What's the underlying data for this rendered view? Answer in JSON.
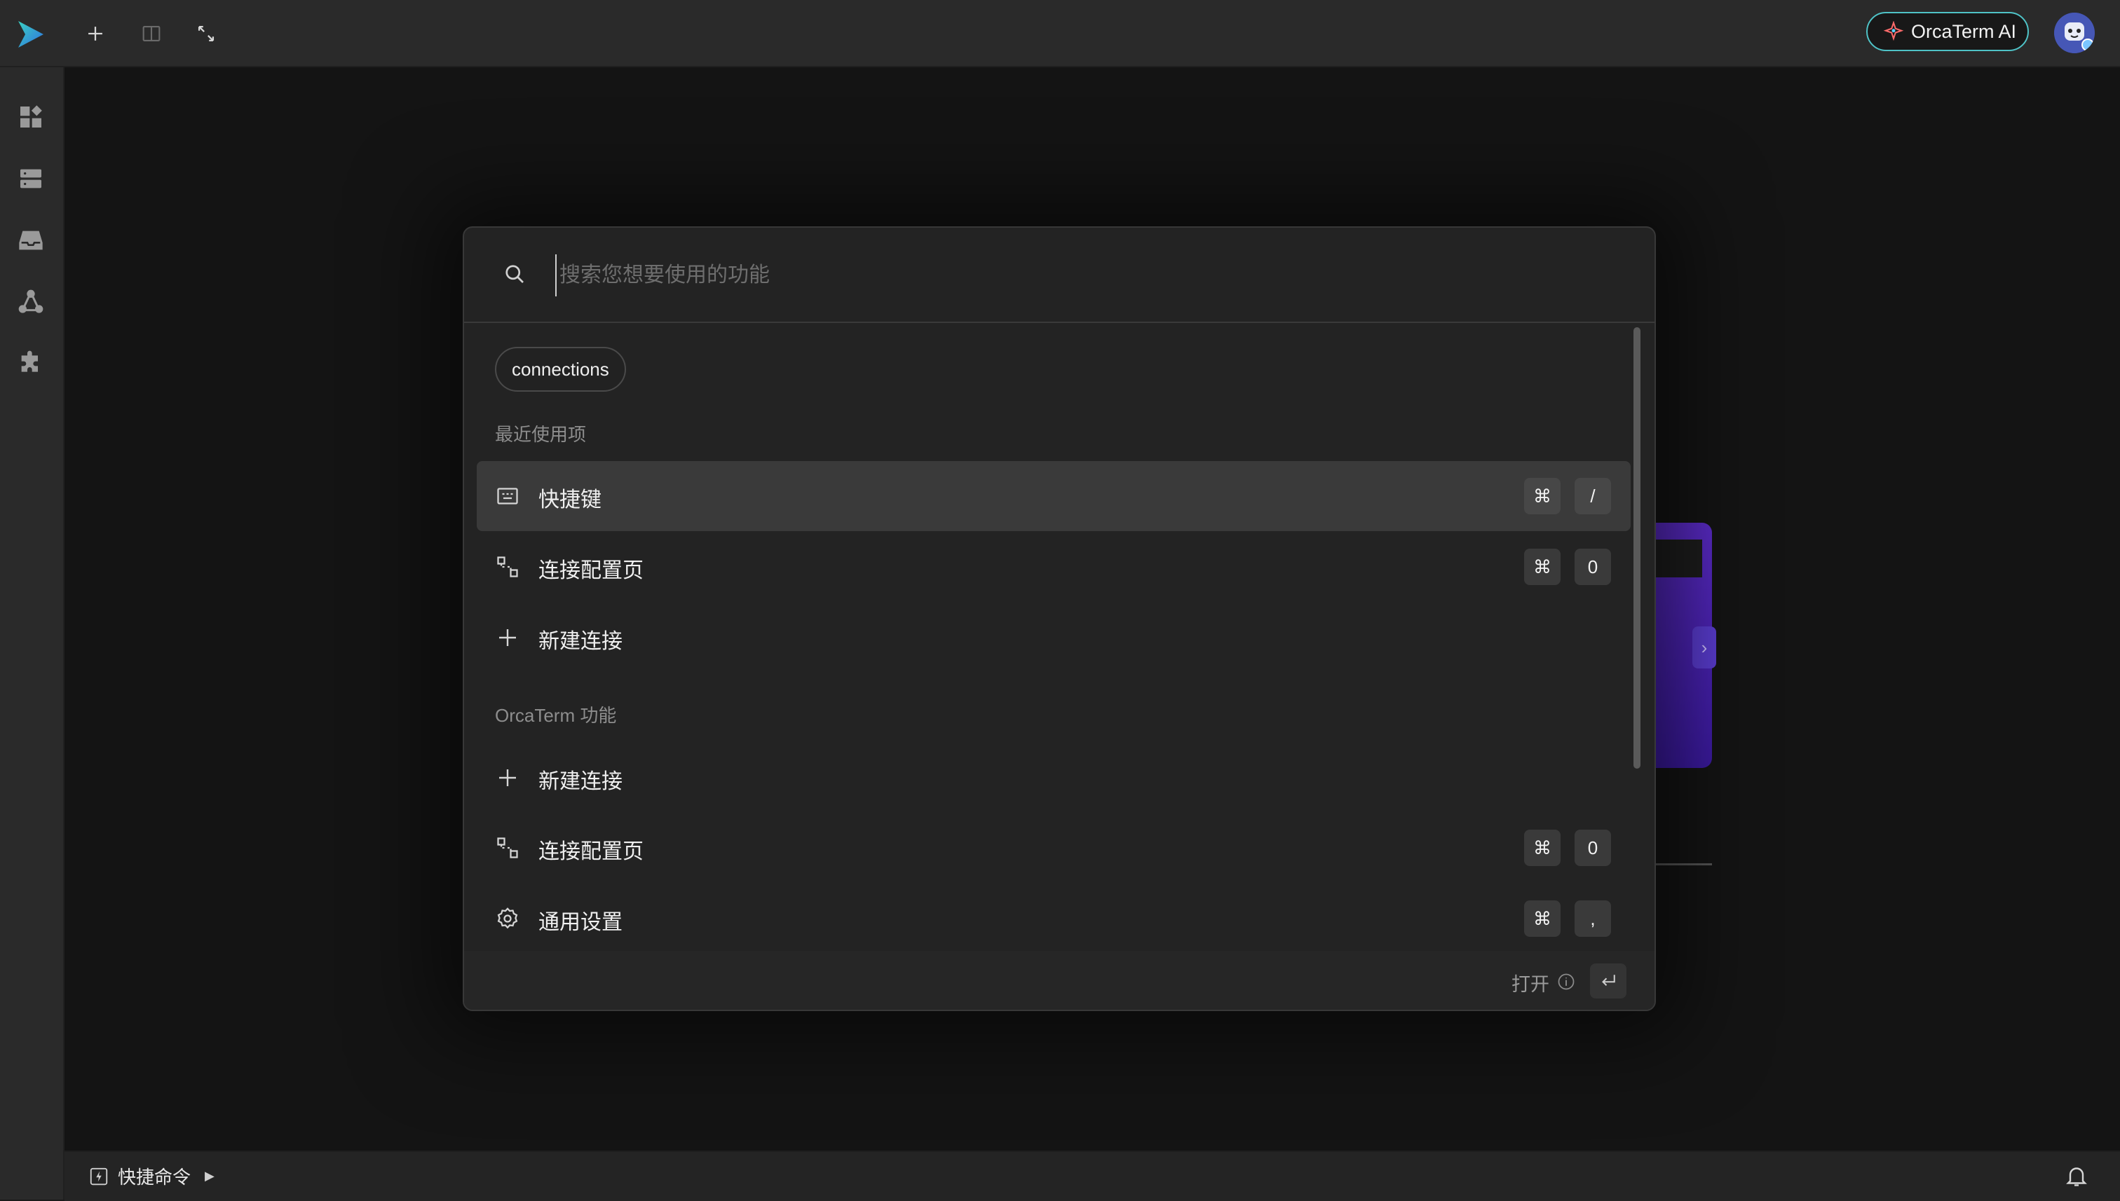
{
  "app": {
    "ai_button_label": "OrcaTerm AI",
    "accent": "#4fc3c7"
  },
  "topbar": {
    "icons": [
      "add-tab-icon",
      "split-view-icon",
      "expand-icon"
    ]
  },
  "sidebar": {
    "items": [
      {
        "icon": "dashboard-icon"
      },
      {
        "icon": "servers-icon"
      },
      {
        "icon": "inbox-icon"
      },
      {
        "icon": "network-icon"
      },
      {
        "icon": "plugin-icon"
      }
    ]
  },
  "palette": {
    "search_placeholder": "搜索您想要使用的功能",
    "chip_label": "connections",
    "recent_title": "最近使用项",
    "recent": [
      {
        "label": "快捷键",
        "icon": "keyboard-icon",
        "keys": [
          "⌘",
          "/"
        ]
      },
      {
        "label": "连接配置页",
        "icon": "connection-config-icon",
        "keys": [
          "⌘",
          "0"
        ]
      },
      {
        "label": "新建连接",
        "icon": "plus-icon",
        "keys": []
      }
    ],
    "features_title": "OrcaTerm 功能",
    "features": [
      {
        "label": "新建连接",
        "icon": "plus-icon",
        "keys": []
      },
      {
        "label": "连接配置页",
        "icon": "connection-config-icon",
        "keys": [
          "⌘",
          "0"
        ]
      },
      {
        "label": "通用设置",
        "icon": "settings-icon",
        "keys": [
          "⌘",
          ","
        ]
      }
    ],
    "footer_open_label": "打开"
  },
  "statusbar": {
    "quick_command_label": "快捷命令"
  }
}
